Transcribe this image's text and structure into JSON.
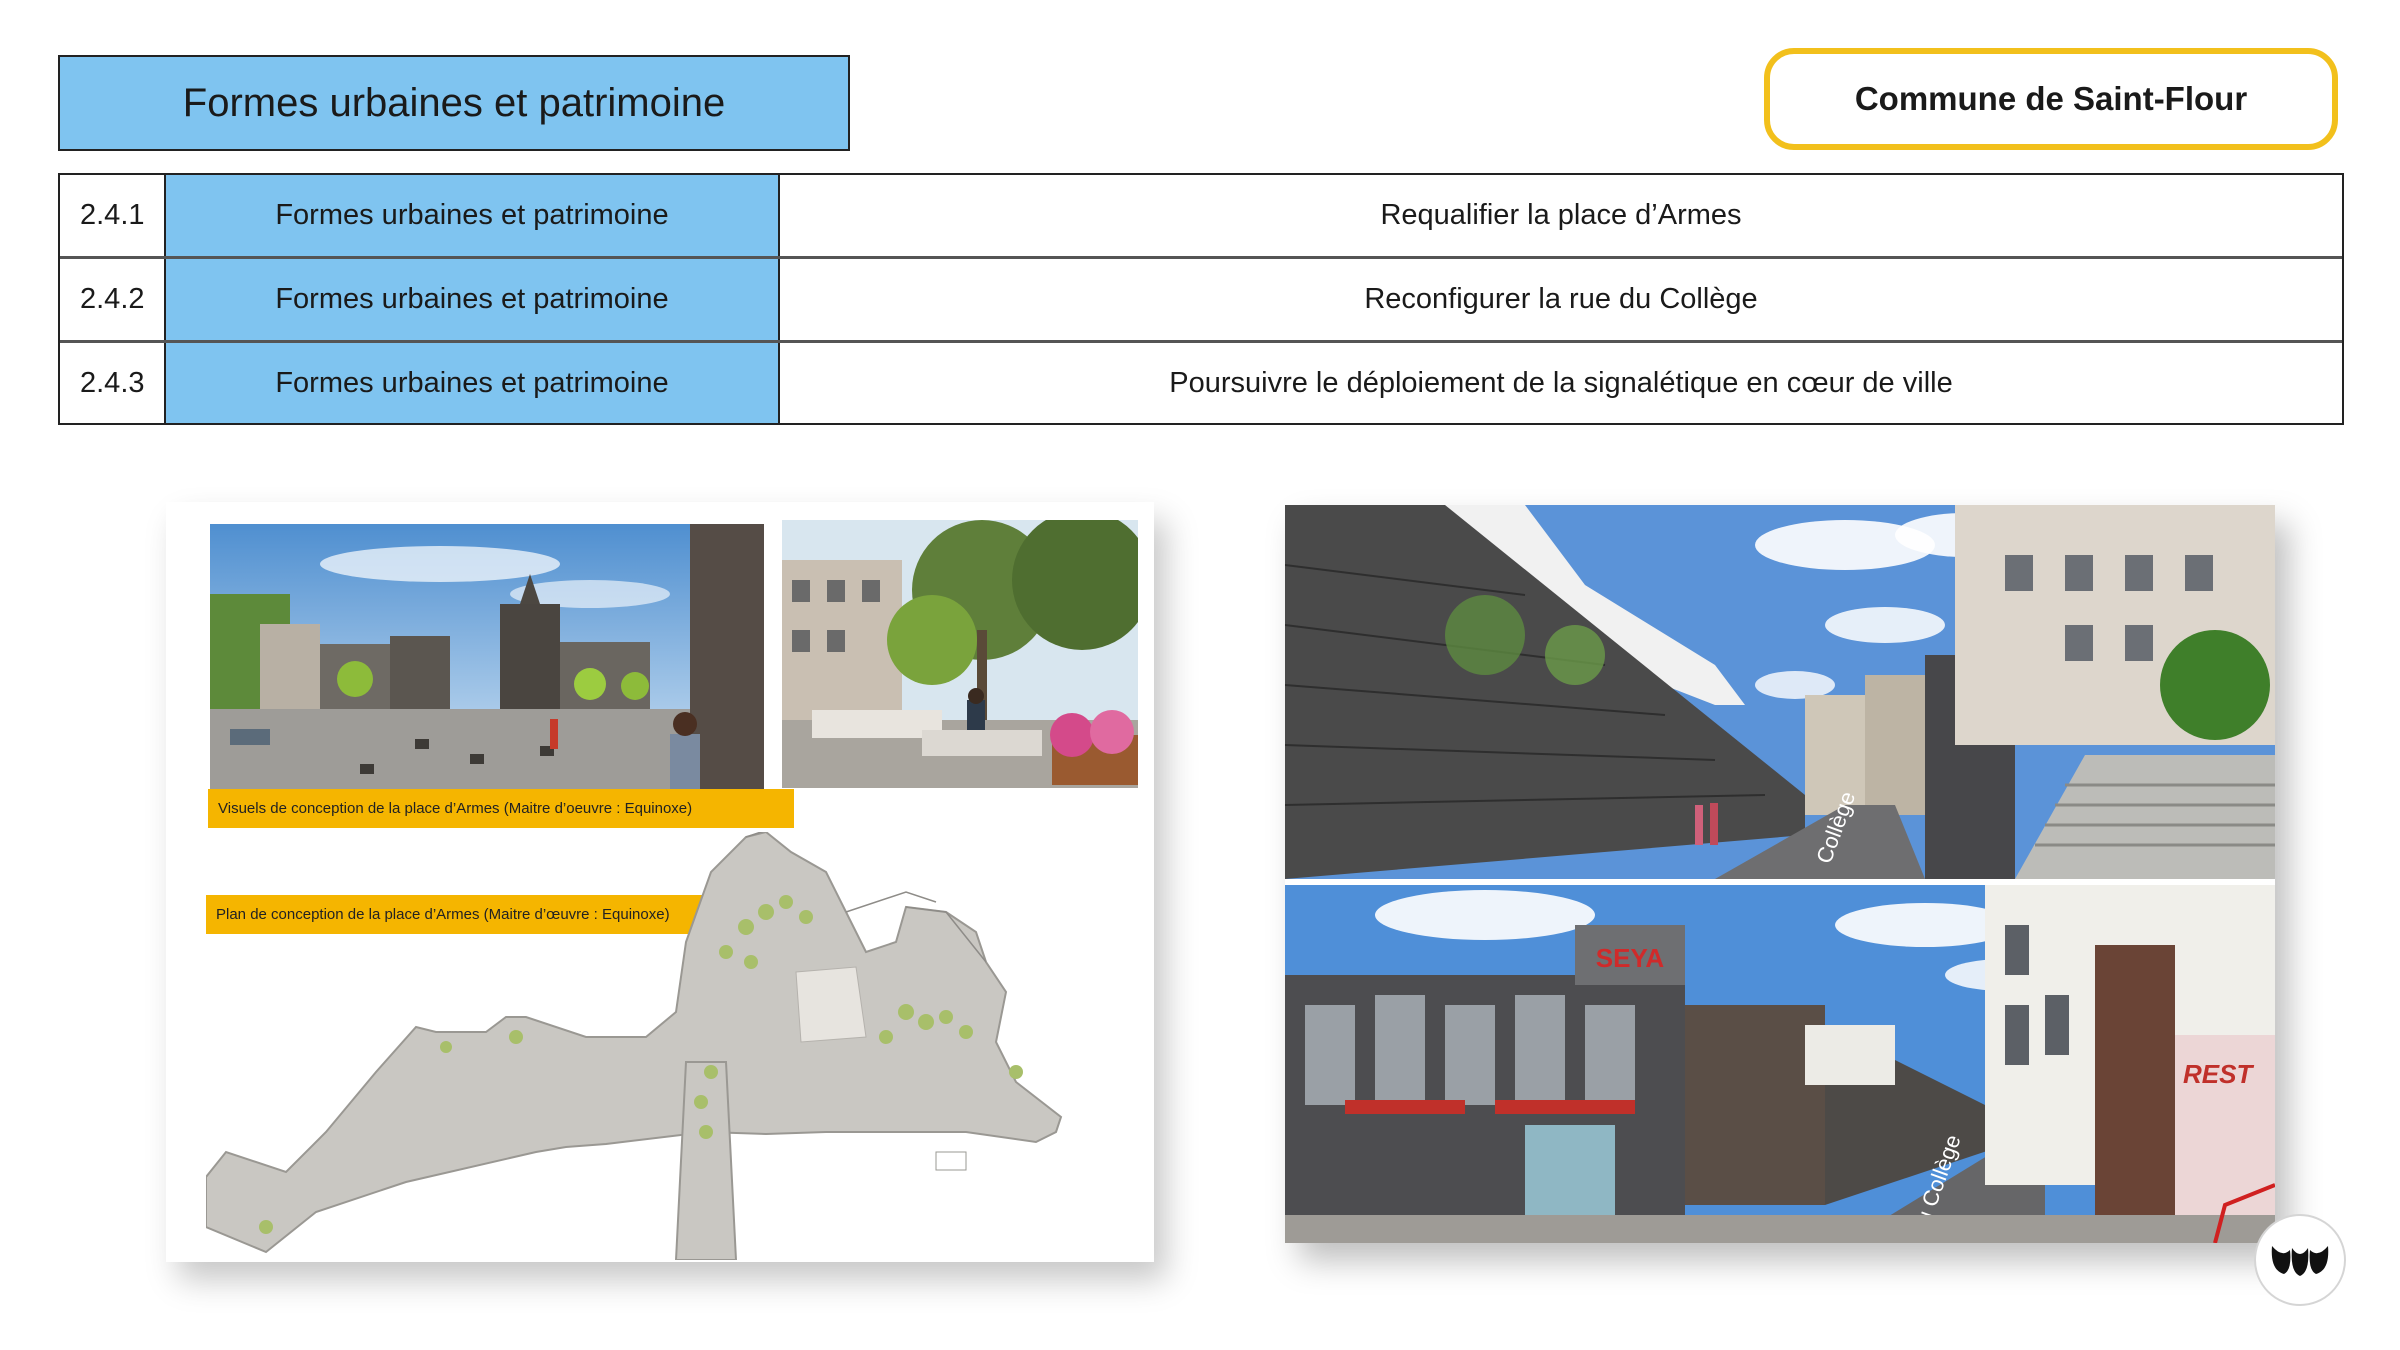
{
  "header": {
    "title": "Formes urbaines et patrimoine",
    "commune": "Commune de Saint-Flour"
  },
  "table": {
    "rows": [
      {
        "num": "2.4.1",
        "theme": "Formes urbaines et patrimoine",
        "action": "Requalifier la place d’Armes"
      },
      {
        "num": "2.4.2",
        "theme": "Formes urbaines et patrimoine",
        "action": "Reconfigurer la rue du Collège"
      },
      {
        "num": "2.4.3",
        "theme": "Formes urbaines et patrimoine",
        "action": "Poursuivre le déploiement de la signalétique en cœur de ville"
      }
    ]
  },
  "left_card": {
    "caption_visuals": "Visuels de conception de la place d’Armes (Maitre d’oeuvre : Equinoxe)",
    "caption_plan": "Plan de conception de la place d’Armes (Maitre d’œuvre : Equinoxe)"
  },
  "right_card": {
    "street_label_top": "Collège",
    "shop_sign": "SEYA",
    "street_label_bottom": "du Collège",
    "rest_sign": "REST"
  },
  "logo": {
    "icon": "brand-logo-icon"
  },
  "colors": {
    "accent_blue": "#7fc4f0",
    "accent_yellow": "#f2c01c",
    "caption_orange": "#f5b500"
  }
}
